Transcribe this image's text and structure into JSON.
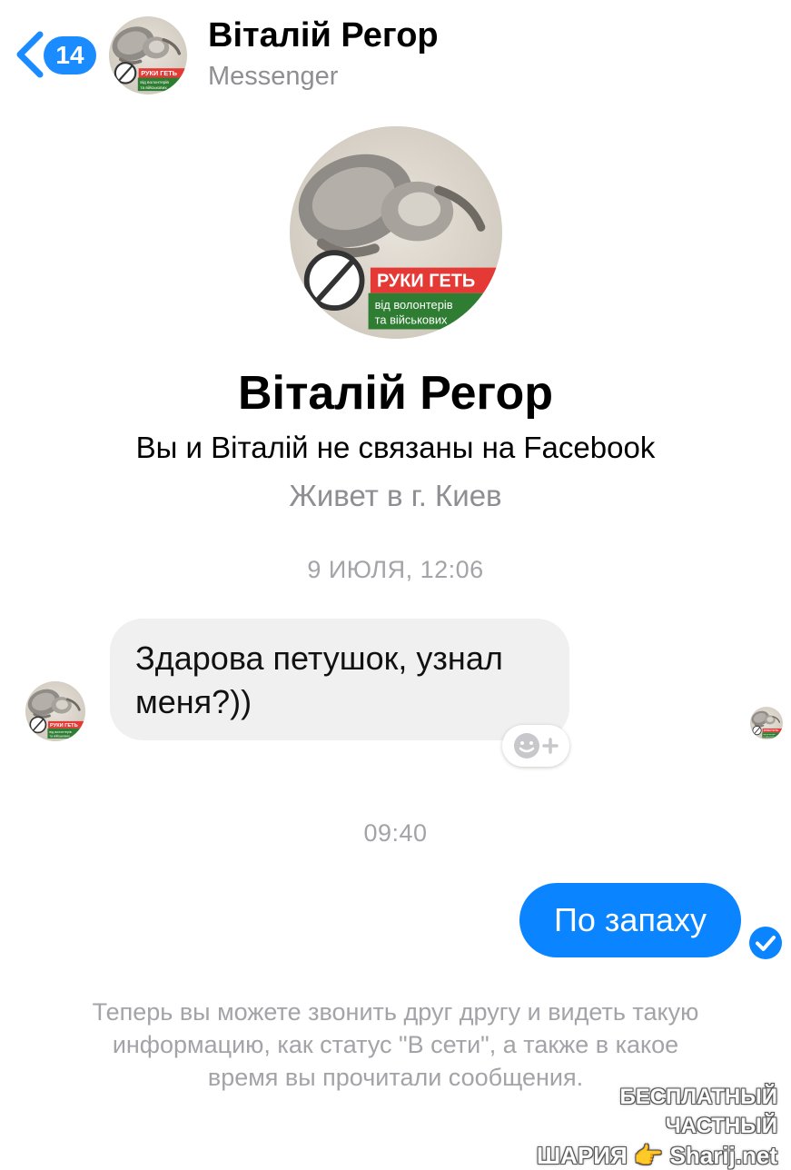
{
  "header": {
    "back_count": "14",
    "contact_name": "Віталій Регор",
    "subtitle": "Messenger"
  },
  "profile": {
    "name": "Віталій Регор",
    "relation": "Вы и Віталій не связаны на Facebook",
    "location": "Живет в г. Киев",
    "avatar_badge": {
      "line1": "РУКИ ГЕТЬ",
      "line2": "від волонтерів",
      "line3": "та військових"
    }
  },
  "conversation": {
    "timestamp_1": "9 ИЮЛЯ, 12:06",
    "incoming_message_line1": "Здарова петушок, узнал",
    "incoming_message_line2": "меня?))",
    "timestamp_2": "09:40",
    "outgoing_message": "По запаху",
    "notice_line1": "Теперь вы можете звонить друг другу и видеть такую",
    "notice_line2": "информацию, как статус \"В сети\", а также в какое",
    "notice_line3": "время вы прочитали сообщения."
  },
  "watermark": {
    "line1": "БЕСПЛАТНЫЙ ЧАСТНЫЙ",
    "line2_a": "ШАРИЯ",
    "line2_b": "Sharij.net"
  },
  "colors": {
    "accent_blue": "#0a84ff",
    "incoming_bubble": "#f0f0f0",
    "secondary_text": "#8e8e93",
    "badge_red": "#e53935",
    "badge_green": "#2e7d32"
  },
  "icons": {
    "back": "chevron-left-icon",
    "react": "smiley-plus-icon",
    "delivered": "check-circle-icon"
  }
}
